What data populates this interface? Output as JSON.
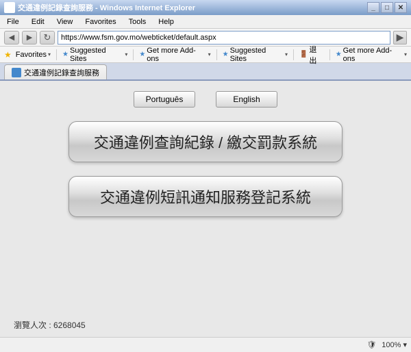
{
  "window": {
    "title": "交通違例記錄查詢服務 - Windows Internet Explorer",
    "icon": "ie-icon"
  },
  "menu": {
    "items": [
      "File",
      "Edit",
      "View",
      "Favorites",
      "Tools",
      "Help"
    ]
  },
  "address": {
    "url": "https://www.fsm.gov.mo/webticket/default.aspx",
    "label": "Address"
  },
  "favorites_bar": {
    "favorites_label": "Favorites",
    "suggested_sites_label": "Suggested Sites",
    "get_more_addons_label": "Get more Add-ons",
    "suggested_sites2_label": "Suggested Sites",
    "exit_label": "退出",
    "get_more_addons2_label": "Get more Add-ons"
  },
  "tabs": [
    {
      "label": "交通違例記錄查詢服務",
      "active": true
    }
  ],
  "page": {
    "lang_buttons": [
      {
        "label": "Português",
        "lang": "pt"
      },
      {
        "label": "English",
        "lang": "en"
      }
    ],
    "main_buttons": [
      {
        "label": "交通違例查詢紀錄 / 繳交罰款系統",
        "id": "btn-query"
      },
      {
        "label": "交通違例短訊通知服務登記系統",
        "id": "btn-sms"
      }
    ],
    "visitor_count_label": "瀏覽人次 : 6268045"
  },
  "status": {
    "text": ""
  }
}
